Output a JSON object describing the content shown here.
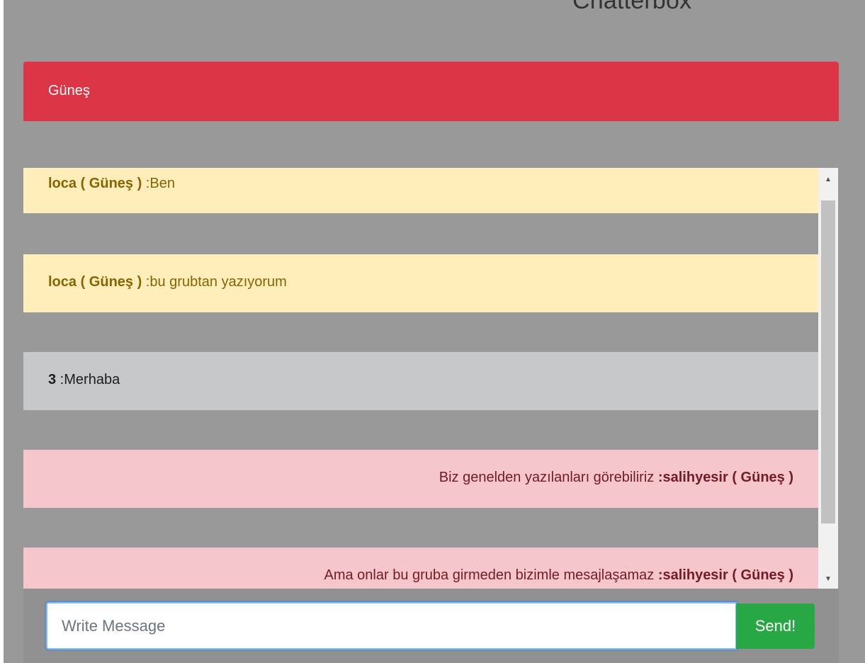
{
  "app": {
    "title": "Chatterbox"
  },
  "group": {
    "name": "Güneş",
    "header_color": "#dc3545"
  },
  "messages": [
    {
      "sender": "loca ( Güneş )",
      "separator": " :",
      "text": "Ben",
      "align": "left",
      "style": "warning"
    },
    {
      "sender": "loca ( Güneş )",
      "separator": " :",
      "text": "bu grubtan yazıyorum",
      "align": "left",
      "style": "warning"
    },
    {
      "sender": "3",
      "separator": " :",
      "text": "Merhaba",
      "align": "left",
      "style": "neutral"
    },
    {
      "text": "Biz genelden yazılanları görebiliriz ",
      "sender": ":salihyesir ( Güneş )",
      "align": "right",
      "style": "danger"
    },
    {
      "text": "Ama onlar bu gruba girmeden bizimle mesajlaşamaz ",
      "sender": ":salihyesir ( Güneş )",
      "align": "right",
      "style": "danger"
    }
  ],
  "composer": {
    "placeholder": "Write Message",
    "value": "",
    "send_label": "Send!"
  },
  "colors": {
    "page_background": "#999999",
    "warning_background": "#ffeeba",
    "neutral_background": "#c6c8ca",
    "danger_background": "#f5c6cb",
    "send_button": "#28a745"
  },
  "icons": {
    "scroll_up": "triangle-up-icon",
    "scroll_down": "triangle-down-icon"
  }
}
